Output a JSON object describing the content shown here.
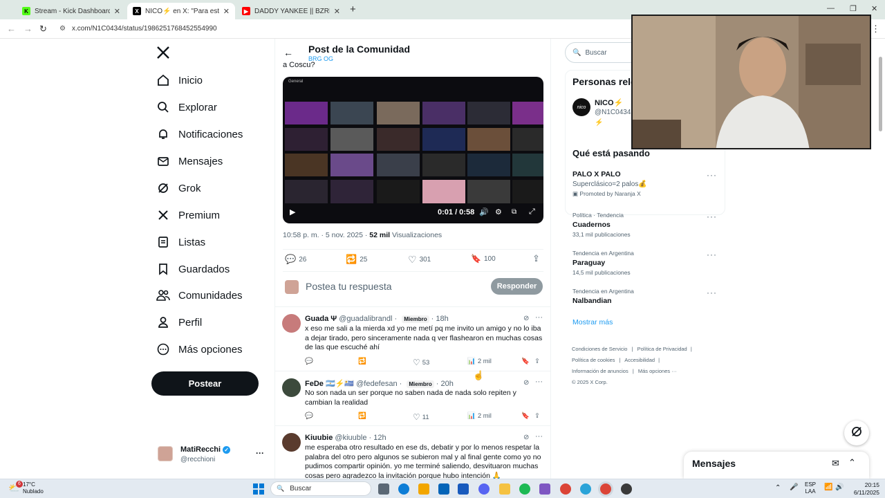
{
  "browser": {
    "tabs": [
      {
        "title": "Stream - Kick Dashboard",
        "favicon": "K",
        "color": "#53fc18"
      },
      {
        "title": "NICO⚡ en X: \"Para esto el und",
        "favicon": "X",
        "color": "#000000"
      },
      {
        "title": "DADDY YANKEE || BZRP Music",
        "favicon": "▶",
        "color": "#ff0000"
      }
    ],
    "new_tab": "+",
    "url": "x.com/N1C0434/status/1986251768452554990"
  },
  "nav": {
    "items": [
      "Inicio",
      "Explorar",
      "Notificaciones",
      "Mensajes",
      "Grok",
      "Premium",
      "Listas",
      "Guardados",
      "Comunidades",
      "Perfil",
      "Más opciones"
    ],
    "post_button": "Postear",
    "account_name": "MatiRecchi",
    "account_handle": "@recchioni",
    "more": "···"
  },
  "header": {
    "title": "Post de la Comunidad",
    "community": "BRG OG",
    "cut_text": "a Coscu?"
  },
  "video": {
    "channel_label": "General",
    "time": "0:01 / 0:58"
  },
  "post_meta": {
    "time": "10:58 p. m. · 5 nov. 2025 · ",
    "views": "52 mil",
    "views_label": " Visualizaciones"
  },
  "post_actions": {
    "replies": "26",
    "reposts": "25",
    "likes": "301",
    "bookmarks": "100"
  },
  "reply_box": {
    "placeholder": "Postea tu respuesta",
    "button": "Responder"
  },
  "replies": [
    {
      "name": "Guada Ψ",
      "handle": "@guadalibrandl",
      "badge": "Miembro",
      "time": "18h",
      "text": "x eso me sali a la mierda xd yo me metí pq me invito un amigo y no lo iba a dejar tirado, pero sinceramente nada q ver flashearon en muchas cosas de las que escuché ahí",
      "likes": "53",
      "views": "2 mil",
      "avatar": "#c77b7b"
    },
    {
      "name": "FeDe 🇦🇷⚡🇺🇾",
      "handle": "@fedefesan",
      "badge": "Miembro",
      "time": "20h",
      "text": "No son nada un ser porque no saben nada de nada solo repiten y cambian la realidad",
      "likes": "11",
      "views": "2 mil",
      "avatar": "#3c4a3c"
    },
    {
      "name": "Kiuubie",
      "handle": "@kiuuble",
      "badge": "",
      "time": "12h",
      "text": "me esperaba otro resultado en ese ds, debatir y por lo menos respetar la palabra del otro pero algunos se subieron mal y al final gente como yo no pudimos compartir opinión. yo me terminé saliendo, desvituaron muchas cosas pero agradezco la invitación porque hubo intención 🙏",
      "likes": "",
      "views": "",
      "avatar": "#5a3b2e"
    }
  ],
  "right": {
    "search_placeholder": "Buscar",
    "people_title": "Personas rele",
    "person_name": "NICO⚡",
    "person_handle": "@N1C0434",
    "person_bio": "⚡",
    "trends_title": "Qué está pasando",
    "trends": [
      {
        "context": "",
        "title": "PALO X PALO",
        "sub": "Superclásico=2 palos💰",
        "meta": "Promoted by Naranja X"
      },
      {
        "context": "Política · Tendencia",
        "title": "Cuadernos",
        "sub": "",
        "meta": "33,1 mil publicaciones"
      },
      {
        "context": "Tendencia en Argentina",
        "title": "Paraguay",
        "sub": "",
        "meta": "14,5 mil publicaciones"
      },
      {
        "context": "Tendencia en Argentina",
        "title": "Nalbandian",
        "sub": "",
        "meta": ""
      }
    ],
    "show_more": "Mostrar más",
    "footer": [
      "Condiciones de Servicio",
      "Política de Privacidad",
      "Política de cookies",
      "Accesibilidad",
      "Información de anuncios",
      "Más opciones ···",
      "© 2025 X Corp."
    ]
  },
  "messages_drawer": {
    "title": "Mensajes"
  },
  "taskbar": {
    "weather_temp": "17°C",
    "weather_text": "Nublado",
    "weather_badge": "6",
    "search": "Buscar",
    "lang": "ESP",
    "lang2": "LAA",
    "time": "20:15",
    "date": "6/11/2025"
  }
}
